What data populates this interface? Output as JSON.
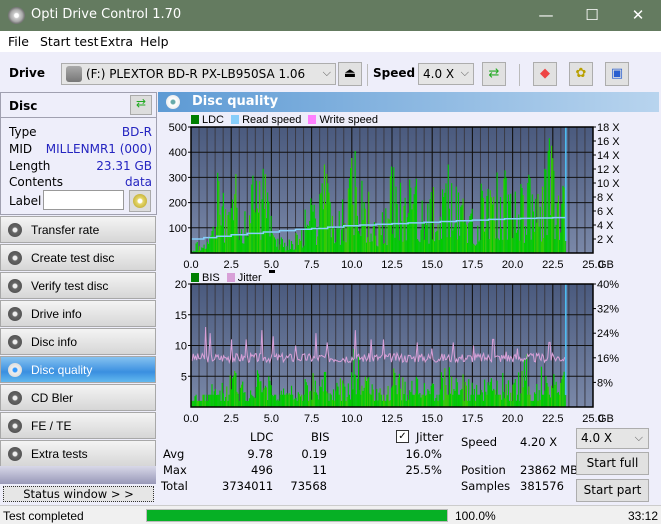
{
  "window": {
    "title": "Opti Drive Control 1.70",
    "minimize": "—",
    "maximize": "☐",
    "close": "✕"
  },
  "menu": [
    "File",
    "Start test",
    "Extra",
    "Help"
  ],
  "toolbar": {
    "drive_label": "Drive",
    "drive_value": "(F:)  PLEXTOR BD-R  PX-LB950SA 1.06",
    "speed_label": "Speed",
    "speed_value": "4.0 X",
    "icons": [
      "eject-icon",
      "refresh-icon",
      "erase-icon",
      "settings-icon",
      "save-icon"
    ]
  },
  "disc": {
    "header": "Disc",
    "rows": [
      {
        "key": "Type",
        "value": "BD-R"
      },
      {
        "key": "MID",
        "value": "MILLENMR1 (000)"
      },
      {
        "key": "Length",
        "value": "23.31 GB"
      },
      {
        "key": "Contents",
        "value": "data"
      }
    ],
    "label_key": "Label",
    "label_value": ""
  },
  "nav": [
    {
      "label": "Transfer rate",
      "active": false
    },
    {
      "label": "Create test disc",
      "active": false
    },
    {
      "label": "Verify test disc",
      "active": false
    },
    {
      "label": "Drive info",
      "active": false
    },
    {
      "label": "Disc info",
      "active": false
    },
    {
      "label": "Disc quality",
      "active": true
    },
    {
      "label": "CD Bler",
      "active": false
    },
    {
      "label": "FE / TE",
      "active": false
    },
    {
      "label": "Extra tests",
      "active": false
    }
  ],
  "status_window_label": "Status window > >",
  "main": {
    "title": "Disc quality"
  },
  "colors": {
    "ldc": "#007f00",
    "read_speed": "#87cefa",
    "write_speed": "#ff80ff",
    "bis": "#007f00",
    "jitter": "#d8a0d8",
    "plot_bg_top": "#4a5a7e",
    "plot_bg_bottom": "#7a88a8",
    "bar_green": "#00cc00"
  },
  "chart_data": [
    {
      "type": "bar",
      "title": "LDC",
      "legend": [
        "LDC",
        "Read speed",
        "Write speed"
      ],
      "xlabel": "GB",
      "x_ticks": [
        "0.0",
        "2.5",
        "5.0",
        "7.5",
        "10.0",
        "12.5",
        "15.0",
        "17.5",
        "20.0",
        "22.5",
        "25.0"
      ],
      "xlim": [
        0,
        25
      ],
      "ylim": [
        0,
        500
      ],
      "y_ticks": [
        "100",
        "200",
        "300",
        "400",
        "500"
      ],
      "y2_ticks": [
        "2 X",
        "4 X",
        "6 X",
        "8 X",
        "10 X",
        "12 X",
        "14 X",
        "16 X",
        "18 X"
      ],
      "y2lim": [
        0,
        18
      ],
      "ldc_peaks": [
        [
          0.5,
          55
        ],
        [
          1.0,
          40
        ],
        [
          1.3,
          80
        ],
        [
          1.6,
          330
        ],
        [
          1.8,
          320
        ],
        [
          2.3,
          160
        ],
        [
          2.6,
          265
        ],
        [
          2.8,
          335
        ],
        [
          3.2,
          200
        ],
        [
          3.6,
          150
        ],
        [
          3.9,
          350
        ],
        [
          4.1,
          355
        ],
        [
          4.5,
          360
        ],
        [
          4.7,
          320
        ],
        [
          5.0,
          160
        ],
        [
          5.5,
          70
        ],
        [
          6.0,
          60
        ],
        [
          6.5,
          80
        ],
        [
          7.0,
          120
        ],
        [
          7.3,
          260
        ],
        [
          7.6,
          200
        ],
        [
          8.0,
          240
        ],
        [
          8.3,
          370
        ],
        [
          8.6,
          310
        ],
        [
          9.0,
          225
        ],
        [
          9.5,
          250
        ],
        [
          10.0,
          400
        ],
        [
          10.3,
          496
        ],
        [
          10.6,
          250
        ],
        [
          11.0,
          250
        ],
        [
          11.5,
          150
        ],
        [
          12.0,
          200
        ],
        [
          12.5,
          380
        ],
        [
          13.0,
          280
        ],
        [
          13.5,
          320
        ],
        [
          14.0,
          300
        ],
        [
          14.5,
          270
        ],
        [
          15.0,
          280
        ],
        [
          15.5,
          300
        ],
        [
          16.0,
          370
        ],
        [
          16.5,
          280
        ],
        [
          17.0,
          260
        ],
        [
          17.5,
          190
        ],
        [
          18.0,
          280
        ],
        [
          18.5,
          280
        ],
        [
          19.0,
          320
        ],
        [
          19.5,
          330
        ],
        [
          20.0,
          300
        ],
        [
          20.5,
          280
        ],
        [
          21.0,
          320
        ],
        [
          21.5,
          250
        ],
        [
          22.0,
          350
        ],
        [
          22.3,
          490
        ],
        [
          22.6,
          250
        ],
        [
          23.0,
          310
        ],
        [
          23.3,
          320
        ]
      ],
      "read_speed": [
        [
          0,
          2.0
        ],
        [
          0.8,
          2.2
        ],
        [
          1.6,
          2.4
        ],
        [
          2.5,
          2.6
        ],
        [
          3.5,
          2.8
        ],
        [
          4.5,
          3.0
        ],
        [
          5.5,
          3.2
        ],
        [
          6.5,
          3.4
        ],
        [
          7.5,
          3.5
        ],
        [
          8.5,
          3.7
        ],
        [
          9.5,
          3.9
        ],
        [
          10.5,
          4.0
        ],
        [
          11.5,
          4.1
        ],
        [
          12.5,
          4.2
        ],
        [
          13.5,
          4.3
        ],
        [
          14.5,
          4.4
        ],
        [
          15.5,
          4.5
        ],
        [
          16.5,
          4.6
        ],
        [
          17.5,
          4.7
        ],
        [
          18.5,
          4.8
        ],
        [
          19.5,
          4.9
        ],
        [
          20.5,
          4.95
        ],
        [
          21.5,
          5.0
        ],
        [
          22.5,
          5.05
        ],
        [
          23.3,
          5.1
        ]
      ],
      "end_marker_gb": 23.31
    },
    {
      "type": "bar",
      "title": "BIS",
      "legend": [
        "BIS",
        "Jitter"
      ],
      "xlabel": "GB",
      "x_ticks": [
        "0.0",
        "2.5",
        "5.0",
        "7.5",
        "10.0",
        "12.5",
        "15.0",
        "17.5",
        "20.0",
        "22.5",
        "25.0"
      ],
      "xlim": [
        0,
        25
      ],
      "ylim": [
        0,
        20
      ],
      "y_ticks": [
        "5",
        "10",
        "15",
        "20"
      ],
      "y2_ticks": [
        "8%",
        "16%",
        "24%",
        "32%",
        "40%"
      ],
      "y2lim": [
        0,
        40
      ],
      "bis_peaks": [
        [
          0.3,
          2
        ],
        [
          1.0,
          2
        ],
        [
          1.6,
          7
        ],
        [
          1.8,
          3
        ],
        [
          2.5,
          6
        ],
        [
          2.7,
          6
        ],
        [
          3.3,
          5
        ],
        [
          3.9,
          8
        ],
        [
          4.1,
          6
        ],
        [
          4.6,
          7
        ],
        [
          5.0,
          2
        ],
        [
          5.5,
          3
        ],
        [
          6.0,
          5
        ],
        [
          6.5,
          3
        ],
        [
          7.0,
          5
        ],
        [
          7.5,
          6
        ],
        [
          8.0,
          7
        ],
        [
          8.3,
          6
        ],
        [
          8.8,
          6
        ],
        [
          9.3,
          5
        ],
        [
          10.0,
          6
        ],
        [
          10.2,
          11
        ],
        [
          10.6,
          7
        ],
        [
          11.0,
          5
        ],
        [
          11.5,
          6
        ],
        [
          12.0,
          5
        ],
        [
          12.5,
          7
        ],
        [
          13.0,
          6
        ],
        [
          13.5,
          6
        ],
        [
          14.0,
          5
        ],
        [
          14.5,
          4
        ],
        [
          15.0,
          4
        ],
        [
          15.5,
          6
        ],
        [
          15.9,
          8
        ],
        [
          16.3,
          6
        ],
        [
          16.8,
          6
        ],
        [
          17.3,
          5
        ],
        [
          17.8,
          4
        ],
        [
          18.3,
          5
        ],
        [
          18.8,
          6
        ],
        [
          19.3,
          6
        ],
        [
          19.8,
          5
        ],
        [
          20.3,
          6
        ],
        [
          20.8,
          9
        ],
        [
          21.3,
          5
        ],
        [
          21.8,
          7
        ],
        [
          22.3,
          8
        ],
        [
          22.8,
          5
        ],
        [
          23.2,
          6
        ]
      ],
      "jitter_avg_pct": 16.0,
      "jitter_spikes": [
        [
          0.9,
          26
        ],
        [
          1.2,
          24
        ],
        [
          2.5,
          22
        ],
        [
          3.4,
          22
        ],
        [
          4.4,
          25
        ],
        [
          5.1,
          23
        ],
        [
          6.5,
          20
        ],
        [
          7.8,
          24
        ],
        [
          8.5,
          21
        ],
        [
          10.2,
          25
        ],
        [
          11.2,
          22
        ],
        [
          12.0,
          22
        ],
        [
          14.1,
          21
        ],
        [
          15.0,
          19
        ],
        [
          16.3,
          21
        ],
        [
          17.6,
          20
        ],
        [
          18.8,
          22
        ],
        [
          19.6,
          18
        ],
        [
          20.3,
          19
        ],
        [
          22.3,
          21
        ]
      ],
      "end_marker_gb": 23.31
    }
  ],
  "stats": {
    "headers": [
      "LDC",
      "BIS"
    ],
    "rows": [
      {
        "label": "Avg",
        "ldc": "9.78",
        "bis": "0.19",
        "jitter": "16.0%"
      },
      {
        "label": "Max",
        "ldc": "496",
        "bis": "11",
        "jitter": "25.5%"
      },
      {
        "label": "Total",
        "ldc": "3734011",
        "bis": "73568"
      }
    ],
    "jitter_label": "Jitter",
    "jitter_checked": true,
    "speed_label": "Speed",
    "speed_value": "4.20 X",
    "position_label": "Position",
    "position_value": "23862 MB",
    "samples_label": "Samples",
    "samples_value": "381576",
    "speed_select": "4.0 X",
    "start_full": "Start full",
    "start_part": "Start part"
  },
  "statusbar": {
    "text": "Test completed",
    "progress_pct": 100.0,
    "progress_text": "100.0%",
    "time": "33:12"
  }
}
